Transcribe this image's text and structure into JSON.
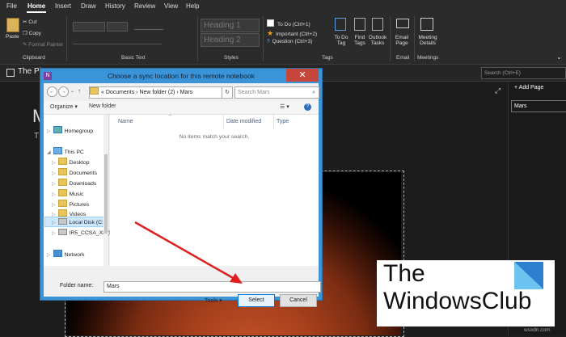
{
  "menu": [
    "File",
    "Home",
    "Insert",
    "Draw",
    "History",
    "Review",
    "View",
    "Help"
  ],
  "menu_active": "Home",
  "ribbon": {
    "clipboard": {
      "paste": "Paste",
      "cut": "Cut",
      "copy": "Copy",
      "format_painter": "Format Painter",
      "label": "Clipboard"
    },
    "basic_text": {
      "label": "Basic Text"
    },
    "styles": {
      "heading1": "Heading 1",
      "heading2": "Heading 2",
      "label": "Styles"
    },
    "tags": {
      "todo": "To Do (Ctrl+1)",
      "important": "Important (Ctrl+2)",
      "question": "Question (Ctrl+3)",
      "todo_tag": "To Do Tag",
      "find_tags": "Find Tags",
      "outlook_tasks": "Outlook Tasks",
      "label": "Tags"
    },
    "email": {
      "email_page": "Email Page",
      "label": "Email"
    },
    "meetings": {
      "meeting_details": "Meeting Details",
      "label": "Meetings"
    }
  },
  "notebook": {
    "title": "The Pl",
    "search_placeholder": "Search (Ctrl+E)"
  },
  "pages": {
    "add_page": "Add Page",
    "items": [
      "Mars"
    ]
  },
  "canvas": {
    "title_letter": "M",
    "subtitle_letter": "T"
  },
  "dialog": {
    "title": "Choose a sync location for this remote notebook",
    "app_icon": "N",
    "address": "«  Documents  ›  New folder (2)  ›  Mars",
    "search_placeholder": "Search Mars",
    "toolbar": {
      "organize": "Organize",
      "new_folder": "New folder"
    },
    "nav_items": [
      {
        "label": "Homegroup",
        "icon": "homegroup",
        "indent": 0
      },
      {
        "label": "This PC",
        "icon": "pc",
        "indent": 0
      },
      {
        "label": "Desktop",
        "icon": "folder",
        "indent": 1
      },
      {
        "label": "Documents",
        "icon": "folder",
        "indent": 1
      },
      {
        "label": "Downloads",
        "icon": "folder",
        "indent": 1
      },
      {
        "label": "Music",
        "icon": "folder",
        "indent": 1
      },
      {
        "label": "Pictures",
        "icon": "folder",
        "indent": 1
      },
      {
        "label": "Videos",
        "icon": "folder",
        "indent": 1
      },
      {
        "label": "Local Disk (C:)",
        "icon": "drive",
        "indent": 1
      },
      {
        "label": "IR5_CCSA_X8 (E:)",
        "icon": "drive",
        "indent": 1
      },
      {
        "label": "Network",
        "icon": "network",
        "indent": 0
      }
    ],
    "selected_nav": "Local Disk (C:)",
    "columns": [
      "Name",
      "Date modified",
      "Type"
    ],
    "empty_text": "No items match your search.",
    "folder_name_label": "Folder name:",
    "folder_name_value": "Mars",
    "tools": "Tools",
    "select": "Select",
    "cancel": "Cancel"
  },
  "logo": {
    "line1": "The",
    "line2": "WindowsClub"
  },
  "watermark": "wsxdn.com",
  "colors": {
    "dialog_frame": "#3c94d8",
    "close": "#c7463c",
    "accent": "#0078d7"
  }
}
